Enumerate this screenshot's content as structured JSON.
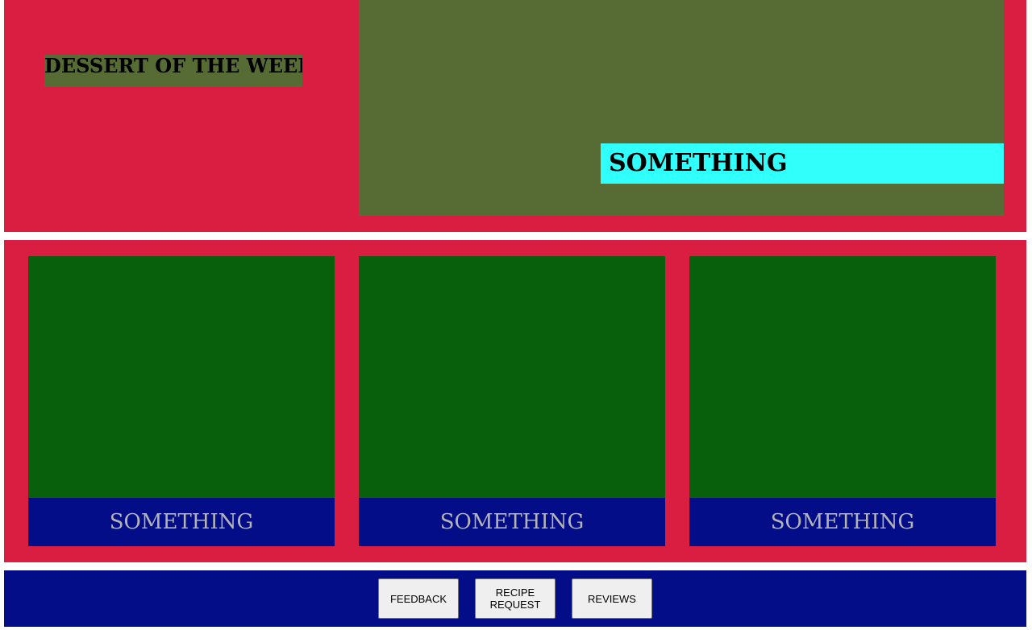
{
  "hero": {
    "title": "DESSERT OF THE WEEK",
    "caption": "SOMETHING"
  },
  "cards": [
    {
      "label": "SOMETHING"
    },
    {
      "label": "SOMETHING"
    },
    {
      "label": "SOMETHING"
    }
  ],
  "footer": {
    "buttons": [
      {
        "label": "FEEDBACK"
      },
      {
        "label": "RECIPE REQUEST"
      },
      {
        "label": "REVIEWS"
      }
    ]
  },
  "colors": {
    "section_background": "#d91e42",
    "hero_image": "#566c34",
    "caption_background": "#30fffc",
    "card_image": "#085f0c",
    "card_label_background": "#040d88",
    "card_label_text": "#b4b4b4",
    "footer_background": "#040d88",
    "button_background": "#efefef"
  }
}
